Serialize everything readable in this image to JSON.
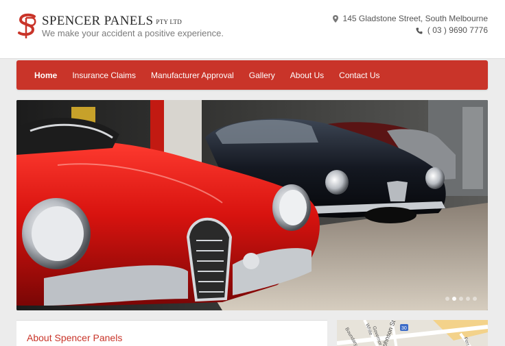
{
  "header": {
    "brand_name": "SPENCER PANELS",
    "brand_suffix": "PTY LTD",
    "tagline": "We make your accident a positive experience.",
    "address": "145 Gladstone Street, South Melbourne",
    "phone": "( 03 ) 9690 7776",
    "accent_color": "#c93429"
  },
  "nav": {
    "items": [
      {
        "label": "Home",
        "active": true
      },
      {
        "label": "Insurance Claims"
      },
      {
        "label": "Manufacturer Approval"
      },
      {
        "label": "Gallery"
      },
      {
        "label": "About Us"
      },
      {
        "label": "Contact Us"
      }
    ]
  },
  "hero": {
    "slide_count": 5,
    "active_slide": 2
  },
  "about": {
    "title": "About Spencer Panels"
  },
  "map": {
    "labels": [
      "Boundary St",
      "White",
      "Governor I",
      "Johnson St",
      "30",
      "Ferr"
    ]
  }
}
